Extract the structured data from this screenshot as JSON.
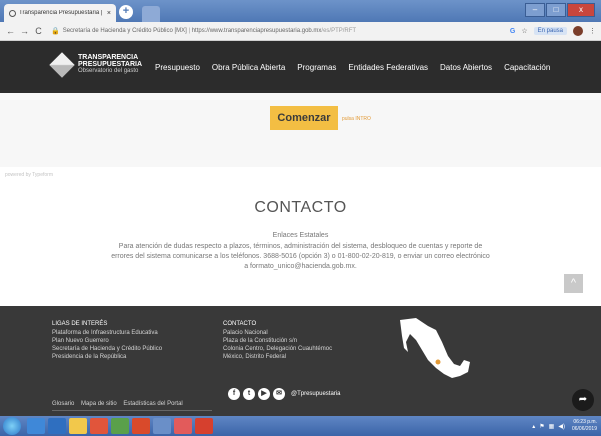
{
  "browser": {
    "tab_title": "Transparencia Presupuestaria | T",
    "tab_close": "×",
    "new_tab": "+",
    "window_controls": [
      "–",
      "□",
      "x"
    ],
    "nav_buttons": [
      "←",
      "→",
      "C"
    ],
    "site_identity": "Secretaría de Hacienda y Crédito Público [MX]",
    "url_host": "https://www.transparenciapresupuestaria.gob.mx",
    "url_path": "/es/PTP/RFT",
    "incognito_label": "En pausa"
  },
  "site": {
    "logo_line1": "TRANSPARENCIA",
    "logo_line2": "PRESUPUESTARIA",
    "logo_line3": "Observatorio del gasto",
    "menu": [
      "Presupuesto",
      "Obra Pública Abierta",
      "Programas",
      "Entidades Federativas",
      "Datos Abiertos",
      "Capacitación"
    ]
  },
  "hero": {
    "button_label": "Comenzar",
    "hint": "pulsa INTRO",
    "powered_by": "powered by Typeform"
  },
  "contact": {
    "title": "CONTACTO",
    "subtitle": "Enlaces Estatales",
    "body": "Para atención de dudas respecto a plazos, términos, administración del sistema, desbloqueo de cuentas y reporte de errores del sistema comunicarse a los teléfonos. 3688-5016 (opción 3) o 01-800-02-20-819, o enviar un correo electrónico a formato_unico@hacienda.gob.mx.",
    "scroll_top": "^"
  },
  "footer": {
    "ligas_heading": "LIGAS DE INTERÉS",
    "ligas": [
      "Plataforma de Infraestructura Educativa",
      "Plan Nuevo Guerrero",
      "Secretaría de Hacienda y Crédito Público",
      "Presidencia de la República"
    ],
    "contacto_heading": "CONTACTO",
    "contacto_lines": [
      "Palacio Nacional",
      "Plaza de la Constitución s/n",
      "Colonia Centro, Delegación Cuauhtémoc",
      "México, Distrito Federal"
    ],
    "bottom_links": [
      "Glosario",
      "Mapa de sitio",
      "Estadísticas del Portal"
    ],
    "social_icons": [
      "f",
      "t",
      "▶",
      "✉"
    ],
    "handle": "@Tpresupuestaria",
    "share": "➦"
  },
  "taskbar": {
    "time": "06:23 p.m.",
    "date": "06/06/2019",
    "icon_colors": [
      "#3f88d8",
      "#2f6fc0",
      "#f2c84b",
      "#e1553b",
      "#5aa04a",
      "#d94a2b",
      "#6a8fc8",
      "#e25b5b",
      "#d6402e"
    ]
  }
}
